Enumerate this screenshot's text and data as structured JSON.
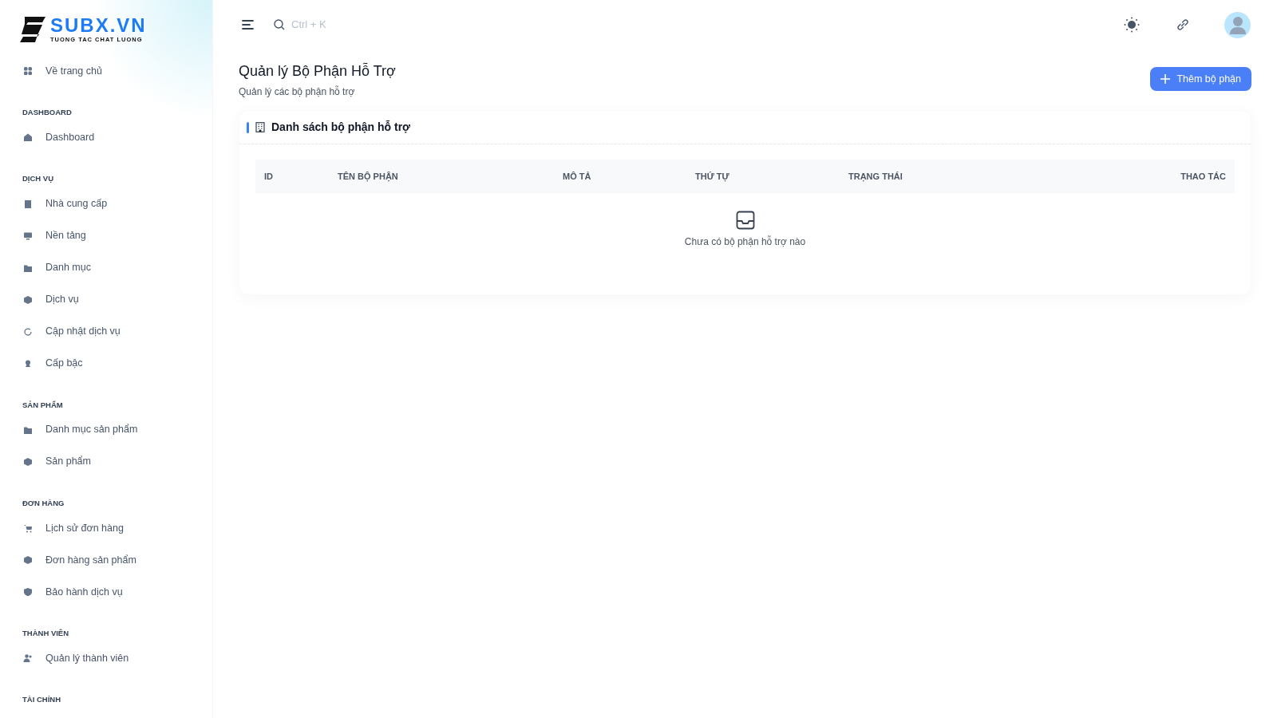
{
  "logo": {
    "name": "SUBX.VN",
    "tagline": "TUONG TAC CHAT LUONG"
  },
  "home_link": {
    "label": "Về trang chủ"
  },
  "sidebar": [
    {
      "heading": "DASHBOARD",
      "items": [
        {
          "label": "Dashboard"
        }
      ]
    },
    {
      "heading": "DỊCH VỤ",
      "items": [
        {
          "label": "Nhà cung cấp"
        },
        {
          "label": "Nền tảng"
        },
        {
          "label": "Danh mục"
        },
        {
          "label": "Dịch vụ"
        },
        {
          "label": "Cập nhật dịch vụ"
        },
        {
          "label": "Cấp bậc"
        }
      ]
    },
    {
      "heading": "SẢN PHẨM",
      "items": [
        {
          "label": "Danh mục sản phẩm"
        },
        {
          "label": "Sản phẩm"
        }
      ]
    },
    {
      "heading": "ĐƠN HÀNG",
      "items": [
        {
          "label": "Lịch sử đơn hàng"
        },
        {
          "label": "Đơn hàng sản phẩm"
        },
        {
          "label": "Bảo hành dịch vụ"
        }
      ]
    },
    {
      "heading": "THÀNH VIÊN",
      "items": [
        {
          "label": "Quản lý thành viên"
        }
      ]
    },
    {
      "heading": "TÀI CHÍNH"
    }
  ],
  "topbar": {
    "search": {
      "placeholder": "Ctrl + K"
    }
  },
  "page": {
    "title": "Quản lý Bộ Phận Hỗ Trợ",
    "subtitle": "Quản lý các bộ phận hỗ trợ",
    "add_button": "Thêm bộ phận"
  },
  "card": {
    "title": "Danh sách bộ phận hỗ trợ",
    "table": {
      "columns": [
        "ID",
        "TÊN BỘ PHẬN",
        "MÔ TẢ",
        "THỨ TỰ",
        "TRẠNG THÁI",
        "THAO TÁC"
      ]
    },
    "empty_message": "Chưa có bộ phận hỗ trợ nào"
  }
}
